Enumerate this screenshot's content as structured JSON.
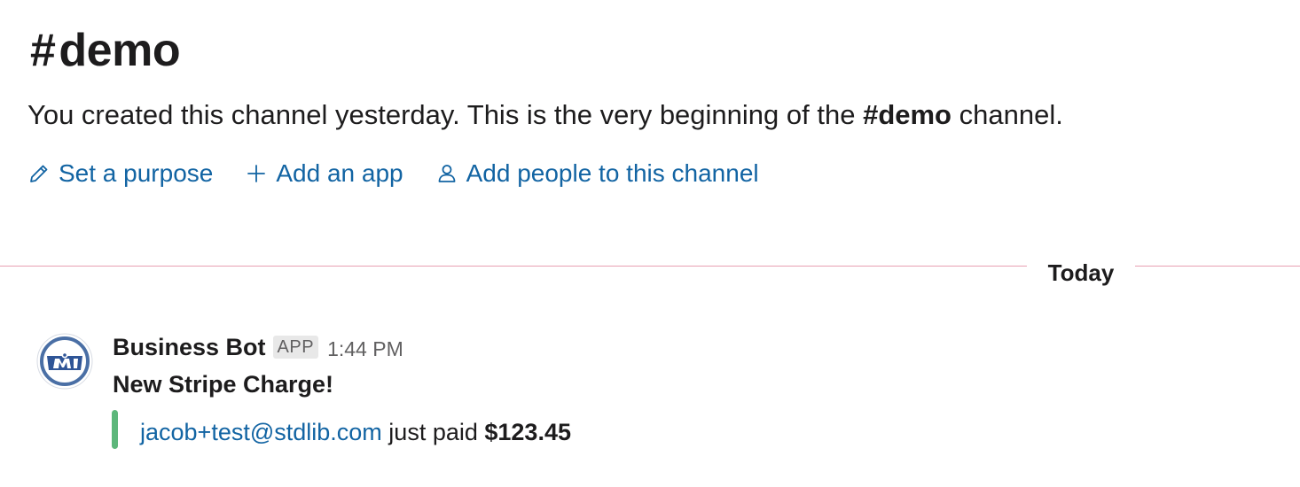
{
  "channel": {
    "hash": "#",
    "name": "demo"
  },
  "intro": {
    "prefix": "You created this channel yesterday. This is the very beginning of the ",
    "channel_ref": "#demo",
    "suffix": " channel."
  },
  "actions": [
    {
      "icon": "pencil-icon",
      "label": "Set a purpose"
    },
    {
      "icon": "plus-icon",
      "label": "Add an app"
    },
    {
      "icon": "person-icon",
      "label": "Add people to this channel"
    }
  ],
  "divider": {
    "label": "Today",
    "color": "#e8a0b2"
  },
  "message": {
    "sender": "Business Bot",
    "badge": "APP",
    "time": "1:44 PM",
    "text": "New Stripe Charge!",
    "attachment": {
      "email": "jacob+test@stdlib.com",
      "middle": " just paid ",
      "amount": "$123.45",
      "bar_color": "#5db77b"
    }
  },
  "colors": {
    "link": "#1264a3",
    "text": "#1d1c1d",
    "muted": "#616061"
  }
}
